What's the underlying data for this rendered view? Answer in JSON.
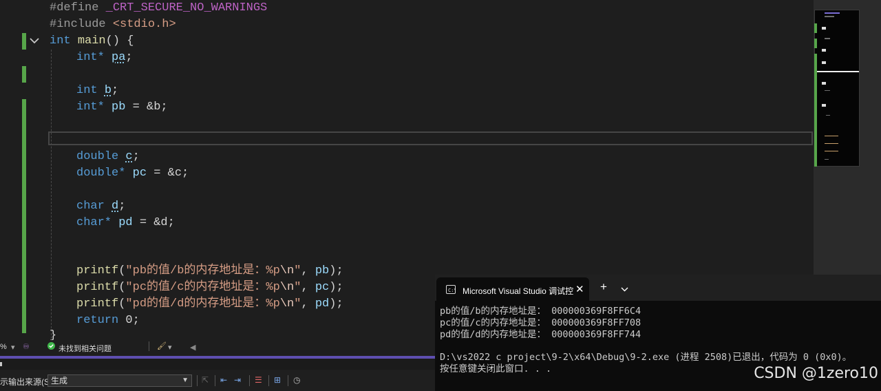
{
  "code": {
    "l1": {
      "directive": "#define",
      "macro": "_CRT_SECURE_NO_WARNINGS"
    },
    "l2": {
      "directive": "#include",
      "header": "<stdio.h>"
    },
    "l3": {
      "type": "int",
      "name": "main",
      "rest": "() {"
    },
    "l4": {
      "type": "int*",
      "var": "pa",
      "end": ";"
    },
    "l5": {
      "type": "int",
      "var": "b",
      "end": ";"
    },
    "l6": {
      "type": "int*",
      "var": "pb",
      "rest": " = &b;"
    },
    "l7": {
      "type": "double",
      "var": "c",
      "end": ";"
    },
    "l8": {
      "type": "double*",
      "var": "pc",
      "rest": " = &c;"
    },
    "l9": {
      "type": "char",
      "var": "d",
      "end": ";"
    },
    "l10": {
      "type": "char*",
      "var": "pd",
      "rest": " = &d;"
    },
    "p1": {
      "fn": "printf",
      "open": "(",
      "str": "\"pb的值/b的内存地址是：%p",
      "esc": "\\n",
      "close": "\"",
      "sep": ", ",
      "arg": "pb",
      "end": ");"
    },
    "p2": {
      "fn": "printf",
      "open": "(",
      "str": "\"pc的值/c的内存地址是：%p",
      "esc": "\\n",
      "close": "\"",
      "sep": ", ",
      "arg": "pc",
      "end": ");"
    },
    "p3": {
      "fn": "printf",
      "open": "(",
      "str": "\"pd的值/d的内存地址是：%p",
      "esc": "\\n",
      "close": "\"",
      "sep": ", ",
      "arg": "pd",
      "end": ");"
    },
    "ret": {
      "kw": "return",
      "rest": " 0;"
    },
    "brace": "}"
  },
  "status": {
    "zoom": "%",
    "issues": "未找到相关问题"
  },
  "output": {
    "source_label": "示输出来源(S):",
    "source_value": "生成"
  },
  "console": {
    "tab_title": "Microsoft Visual Studio 调试控",
    "lines": [
      "pb的值/b的内存地址是： 000000369F8FF6C4",
      "pc的值/c的内存地址是： 000000369F8FF708",
      "pd的值/d的内存地址是： 000000369F8FF744",
      "",
      "D:\\vs2022 c project\\9-2\\x64\\Debug\\9-2.exe (进程 2508)已退出，代码为 0 (0x0)。",
      "按任意键关闭此窗口. . ."
    ]
  },
  "watermark": "CSDN @1zero10",
  "colors": {
    "accent": "#5e4fb0",
    "change_bar": "#57a64a",
    "keyword": "#569cd6",
    "string": "#d69d85"
  }
}
